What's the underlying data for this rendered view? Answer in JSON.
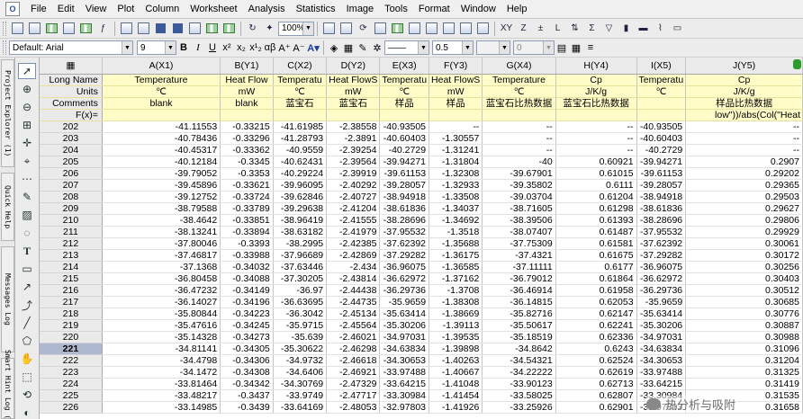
{
  "menu": [
    "File",
    "Edit",
    "View",
    "Plot",
    "Column",
    "Worksheet",
    "Analysis",
    "Statistics",
    "Image",
    "Tools",
    "Format",
    "Window",
    "Help"
  ],
  "toolbar": {
    "zoom": "100%"
  },
  "format": {
    "template": "Default: Arial",
    "font_size": "9",
    "bold": "B",
    "italic": "I",
    "underline": "U",
    "line_width": "0.5",
    "value_box": "0"
  },
  "side_tabs": [
    "Project Explorer (1)",
    "Quick Help",
    "Messages Log",
    "Smart Hint Log (2)"
  ],
  "columns": [
    {
      "name": "A(X1)",
      "long": "Temperature",
      "units": "℃",
      "comments": "blank",
      "f": ""
    },
    {
      "name": "B(Y1)",
      "long": "Heat Flow",
      "units": "mW",
      "comments": "blank",
      "f": ""
    },
    {
      "name": "C(X2)",
      "long": "Temperatu",
      "units": "℃",
      "comments": "蓝宝石",
      "f": ""
    },
    {
      "name": "D(Y2)",
      "long": "Heat FlowS",
      "units": "mW",
      "comments": "蓝宝石",
      "f": ""
    },
    {
      "name": "E(X3)",
      "long": "Temperatu",
      "units": "℃",
      "comments": "样品",
      "f": ""
    },
    {
      "name": "F(Y3)",
      "long": "Heat FlowS",
      "units": "mW",
      "comments": "样品",
      "f": ""
    },
    {
      "name": "G(X4)",
      "long": "Temperature",
      "units": "℃",
      "comments": "蓝宝石比热数据",
      "f": ""
    },
    {
      "name": "H(Y4)",
      "long": "Cp",
      "units": "J/K/g",
      "comments": "蓝宝石比热数据",
      "f": ""
    },
    {
      "name": "I(X5)",
      "long": "Temperatu",
      "units": "℃",
      "comments": "",
      "f": ""
    },
    {
      "name": "J(Y5)",
      "long": "Cp",
      "units": "J/K/g",
      "comments": "样品比热数据",
      "f": "low\"))/abs(Col(\"Heat"
    }
  ],
  "row_labels": {
    "long": "Long Name",
    "units": "Units",
    "comments": "Comments",
    "f": "F(x)="
  },
  "active_row": "221",
  "rows": [
    [
      "202",
      "-41.11553",
      "-0.33215",
      "-41.61985",
      "-2.38558",
      "-40.93505",
      "--",
      "--",
      "--",
      "-40.93505",
      "--"
    ],
    [
      "203",
      "-40.78436",
      "-0.33296",
      "-41.28793",
      "-2.3891",
      "-40.60403",
      "-1.30557",
      "--",
      "--",
      "-40.60403",
      "--"
    ],
    [
      "204",
      "-40.45317",
      "-0.33362",
      "-40.9559",
      "-2.39254",
      "-40.2729",
      "-1.31241",
      "--",
      "--",
      "-40.2729",
      "--"
    ],
    [
      "205",
      "-40.12184",
      "-0.3345",
      "-40.62431",
      "-2.39564",
      "-39.94271",
      "-1.31804",
      "-40",
      "0.60921",
      "-39.94271",
      "0.2907"
    ],
    [
      "206",
      "-39.79052",
      "-0.3353",
      "-40.29224",
      "-2.39919",
      "-39.61153",
      "-1.32308",
      "-39.67901",
      "0.61015",
      "-39.61153",
      "0.29202"
    ],
    [
      "207",
      "-39.45896",
      "-0.33621",
      "-39.96095",
      "-2.40292",
      "-39.28057",
      "-1.32933",
      "-39.35802",
      "0.6111",
      "-39.28057",
      "0.29365"
    ],
    [
      "208",
      "-39.12752",
      "-0.33724",
      "-39.62846",
      "-2.40727",
      "-38.94918",
      "-1.33508",
      "-39.03704",
      "0.61204",
      "-38.94918",
      "0.29503"
    ],
    [
      "209",
      "-38.79588",
      "-0.33789",
      "-39.29638",
      "-2.41204",
      "-38.61836",
      "-1.34037",
      "-38.71605",
      "0.61298",
      "-38.61836",
      "0.29627"
    ],
    [
      "210",
      "-38.4642",
      "-0.33851",
      "-38.96419",
      "-2.41555",
      "-38.28696",
      "-1.34692",
      "-38.39506",
      "0.61393",
      "-38.28696",
      "0.29806"
    ],
    [
      "211",
      "-38.13241",
      "-0.33894",
      "-38.63182",
      "-2.41979",
      "-37.95532",
      "-1.3518",
      "-38.07407",
      "0.61487",
      "-37.95532",
      "0.29929"
    ],
    [
      "212",
      "-37.80046",
      "-0.3393",
      "-38.2995",
      "-2.42385",
      "-37.62392",
      "-1.35688",
      "-37.75309",
      "0.61581",
      "-37.62392",
      "0.30061"
    ],
    [
      "213",
      "-37.46817",
      "-0.33988",
      "-37.96689",
      "-2.42869",
      "-37.29282",
      "-1.36175",
      "-37.4321",
      "0.61675",
      "-37.29282",
      "0.30172"
    ],
    [
      "214",
      "-37.1368",
      "-0.34032",
      "-37.63446",
      "-2.434",
      "-36.96075",
      "-1.36585",
      "-37.11111",
      "0.6177",
      "-36.96075",
      "0.30256"
    ],
    [
      "215",
      "-36.80458",
      "-0.34088",
      "-37.30205",
      "-2.43814",
      "-36.62972",
      "-1.37162",
      "-36.79012",
      "0.61864",
      "-36.62972",
      "0.30403"
    ],
    [
      "216",
      "-36.47232",
      "-0.34149",
      "-36.97",
      "-2.44438",
      "-36.29736",
      "-1.3708",
      "-36.46914",
      "0.61958",
      "-36.29736",
      "0.30512"
    ],
    [
      "217",
      "-36.14027",
      "-0.34196",
      "-36.63695",
      "-2.44735",
      "-35.9659",
      "-1.38308",
      "-36.14815",
      "0.62053",
      "-35.9659",
      "0.30685"
    ],
    [
      "218",
      "-35.80844",
      "-0.34223",
      "-36.3042",
      "-2.45134",
      "-35.63414",
      "-1.38669",
      "-35.82716",
      "0.62147",
      "-35.63414",
      "0.30776"
    ],
    [
      "219",
      "-35.47616",
      "-0.34245",
      "-35.9715",
      "-2.45564",
      "-35.30206",
      "-1.39113",
      "-35.50617",
      "0.62241",
      "-35.30206",
      "0.30887"
    ],
    [
      "220",
      "-35.14328",
      "-0.34273",
      "-35.639",
      "-2.46021",
      "-34.97031",
      "-1.39535",
      "-35.18519",
      "0.62336",
      "-34.97031",
      "0.30988"
    ],
    [
      "221",
      "-34.81141",
      "-0.34305",
      "-35.30622",
      "-2.46298",
      "-34.63834",
      "-1.39898",
      "-34.8642",
      "0.6243",
      "-34.63834",
      "0.31096"
    ],
    [
      "222",
      "-34.4798",
      "-0.34306",
      "-34.9732",
      "-2.46618",
      "-34.30653",
      "-1.40263",
      "-34.54321",
      "0.62524",
      "-34.30653",
      "0.31204"
    ],
    [
      "223",
      "-34.1472",
      "-0.34308",
      "-34.6406",
      "-2.46921",
      "-33.97488",
      "-1.40667",
      "-34.22222",
      "0.62619",
      "-33.97488",
      "0.31325"
    ],
    [
      "224",
      "-33.81464",
      "-0.34342",
      "-34.30769",
      "-2.47329",
      "-33.64215",
      "-1.41048",
      "-33.90123",
      "0.62713",
      "-33.64215",
      "0.31419"
    ],
    [
      "225",
      "-33.48217",
      "-0.3437",
      "-33.9749",
      "-2.47717",
      "-33.30984",
      "-1.41454",
      "-33.58025",
      "0.62807",
      "-33.30984",
      "0.31535"
    ],
    [
      "226",
      "-33.14985",
      "-0.3439",
      "-33.64169",
      "-2.48053",
      "-32.97803",
      "-1.41926",
      "-33.25926",
      "0.62901",
      "-32.97803",
      "0.31658"
    ]
  ],
  "watermark": "热分析与吸附"
}
